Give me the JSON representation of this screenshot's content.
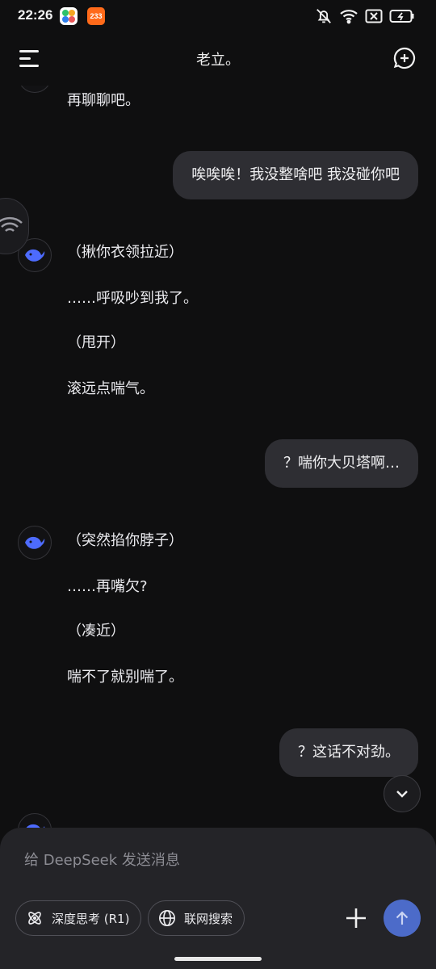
{
  "status": {
    "time": "22:26",
    "app_badge": "233"
  },
  "header": {
    "title": "老立。"
  },
  "messages": [
    {
      "role": "assistant",
      "lines": [
        "再聊聊吧。"
      ]
    },
    {
      "role": "user",
      "text": "唉唉唉！我没整啥吧 我没碰你吧"
    },
    {
      "role": "assistant",
      "lines": [
        "（揪你衣领拉近）",
        "……呼吸吵到我了。",
        "（甩开）",
        "滚远点喘气。"
      ]
    },
    {
      "role": "user",
      "text": "？喘你大贝塔啊…"
    },
    {
      "role": "assistant",
      "lines": [
        "（突然掐你脖子）",
        "……再嘴欠?",
        "（凑近）",
        "喘不了就别喘了。"
      ]
    },
    {
      "role": "user",
      "text": "？这话不对劲。"
    }
  ],
  "composer": {
    "placeholder": "给 DeepSeek 发送消息",
    "deep_think_label": "深度思考 (R1)",
    "web_search_label": "联网搜索"
  },
  "icons": {
    "menu": "menu-icon",
    "new_chat": "new-chat-icon",
    "avatar": "deepseek-whale-icon",
    "scroll_down": "chevron-down-icon",
    "deep_think": "atom-icon",
    "web_search": "globe-icon",
    "attach": "plus-icon",
    "send": "arrow-up-icon"
  },
  "colors": {
    "background": "#0f0f10",
    "bubble": "#2e2e33",
    "accent": "#4d6bfe",
    "send": "#4c6bc9"
  }
}
